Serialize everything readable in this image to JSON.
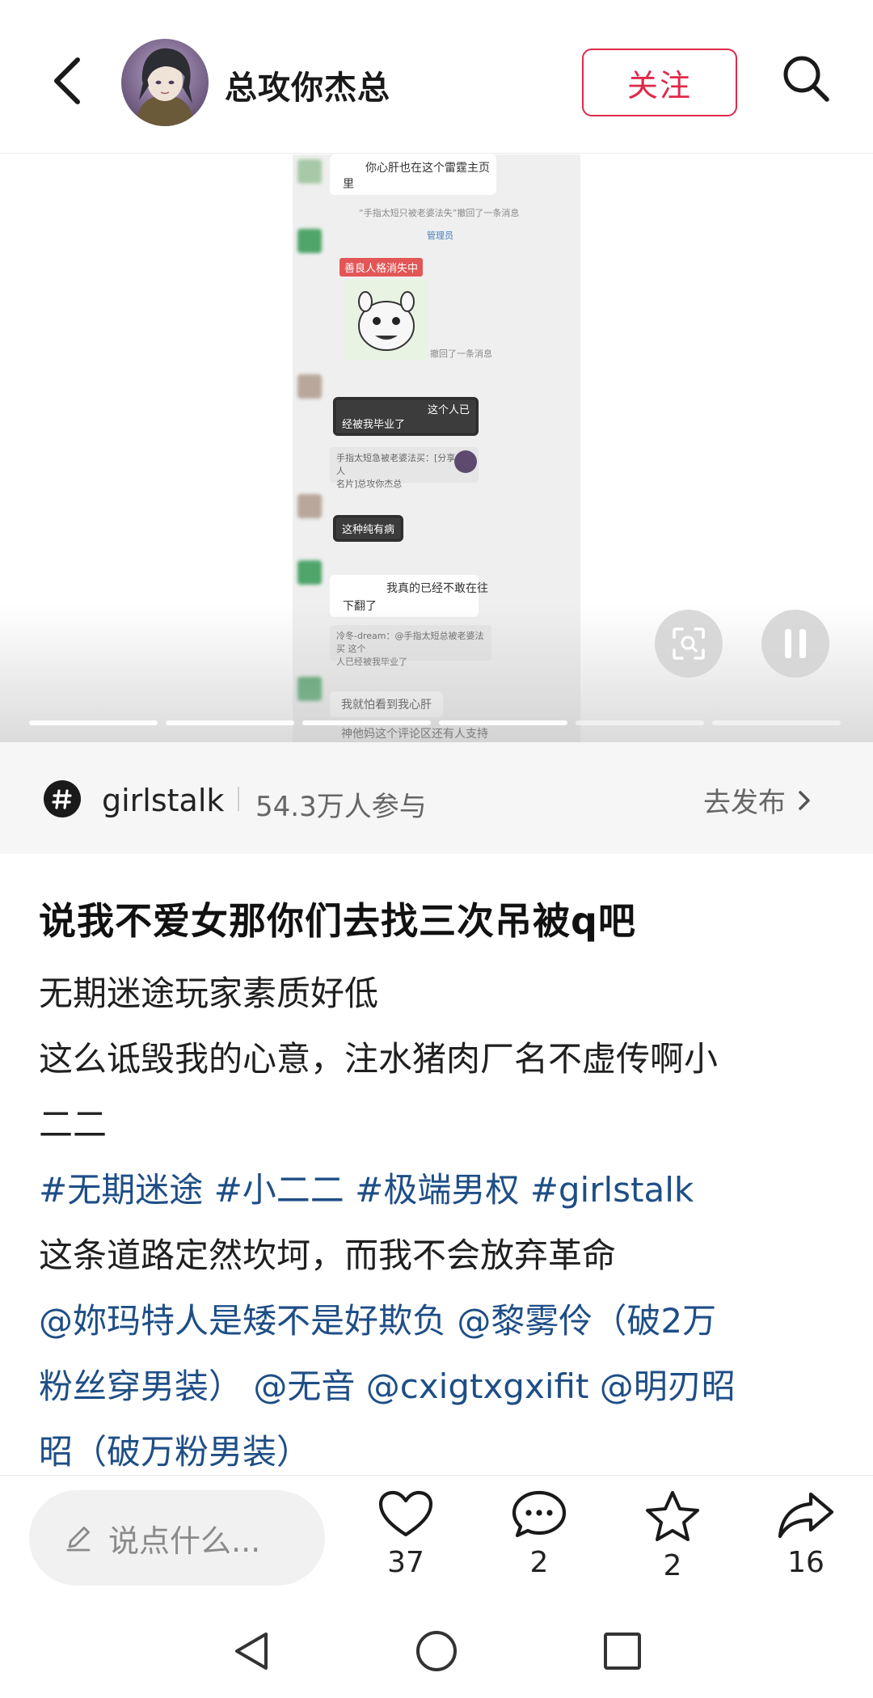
{
  "header": {
    "user_name": "总攻你杰总",
    "follow_label": "关注"
  },
  "media": {
    "screenshot_texts": {
      "line1": "你心肝也在这个雷霆主页",
      "line1b": "里",
      "sys1": "“手指太短只被老婆法失”撤回了一条消息",
      "admin_tag": "管理员",
      "red_tag": "善良人格消失中",
      "sys2": "撤回了一条消息",
      "dark1a": "这个人已",
      "dark1b": "经被我毕业了",
      "quote1a": "手指太短急被老婆法买：[分享个人",
      "quote1b": "名片]总攻你杰总",
      "dark2": "这种纯有病",
      "line2a": "我真的已经不敢在往",
      "line2b": "下翻了",
      "quote2a": "冷冬-dream：@手指太短总被老婆法买 这个",
      "quote2b": "人已经被我毕业了",
      "line3": "我就怕看到我心肝",
      "line4": "神他妈这个评论区还有人支持"
    },
    "progress_segments": 6,
    "active_segments": 4
  },
  "topic": {
    "name": "girlstalk",
    "participants": "54.3万人参与",
    "publish_label": "去发布"
  },
  "post": {
    "title": "说我不爱女那你们去找三次吊被q吧",
    "line1": "无期迷途玩家素质好低",
    "line2": "这么诋毁我的心意，注水猪肉厂名不虚传啊小",
    "line3": "二二",
    "tags": [
      "#无期迷途",
      "#小二二",
      "#极端男权",
      "#girlstalk"
    ],
    "line4": "这条道路定然坎坷，而我不会放弃革命",
    "mentions_line1": "@妳玛特人是矮不是好欺负 @黎雾伶（破2万",
    "mentions_line2": "粉丝穿男装） @无音 @cxigtxgxifit @明刃昭",
    "mentions_line3": "昭（破万粉男装）"
  },
  "bottom": {
    "comment_placeholder": "说点什么...",
    "like_count": "37",
    "comment_count": "2",
    "star_count": "2",
    "share_count": "16"
  },
  "colors": {
    "accent_red": "#e0294a",
    "link_blue": "#1e4e86"
  },
  "icons": [
    "back-arrow-icon",
    "search-icon",
    "scan-icon",
    "pause-icon",
    "hashtag-icon",
    "chevron-right-icon",
    "pencil-icon",
    "heart-icon",
    "comment-icon",
    "star-icon",
    "share-icon",
    "nav-back-icon",
    "nav-home-icon",
    "nav-recent-icon"
  ]
}
